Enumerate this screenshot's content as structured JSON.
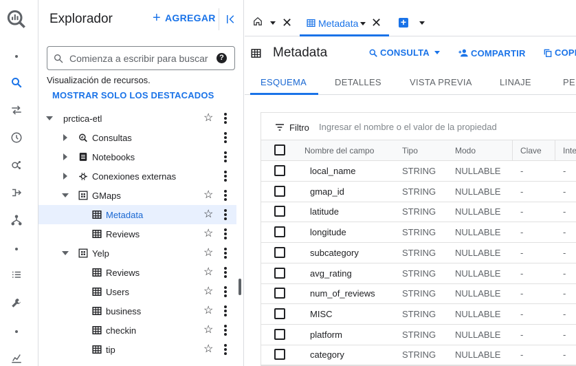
{
  "rail": {
    "items": [
      {
        "icon": "dot"
      },
      {
        "icon": "search-icon"
      },
      {
        "icon": "transfer-icon"
      },
      {
        "icon": "history-icon"
      },
      {
        "icon": "analytics-hub-icon"
      },
      {
        "icon": "dataflow-icon"
      },
      {
        "icon": "workflow-icon"
      },
      {
        "icon": "dot"
      },
      {
        "icon": "list-icon"
      },
      {
        "icon": "wrench-icon"
      },
      {
        "icon": "dot"
      },
      {
        "icon": "chart-icon"
      }
    ]
  },
  "explorer": {
    "title": "Explorador",
    "add_label": "AGREGAR",
    "search_placeholder": "Comienza a escribir para buscar",
    "visibility_text": "Visualización de recursos.",
    "starred_link": "MOSTRAR SOLO LOS DESTACADOS",
    "tree": [
      {
        "label": "prctica-etl",
        "level": 0,
        "caret": "down",
        "icon": "none",
        "star": true
      },
      {
        "label": "Consultas",
        "level": 1,
        "caret": "right",
        "icon": "query-icon",
        "star": false
      },
      {
        "label": "Notebooks",
        "level": 1,
        "caret": "right",
        "icon": "notebook-icon",
        "star": false
      },
      {
        "label": "Conexiones externas",
        "level": 1,
        "caret": "right",
        "icon": "connection-icon",
        "star": false
      },
      {
        "label": "GMaps",
        "level": 1,
        "caret": "down",
        "icon": "dataset-icon",
        "star": true
      },
      {
        "label": "Metadata",
        "level": 2,
        "caret": "none",
        "icon": "table-icon",
        "star": true,
        "selected": true
      },
      {
        "label": "Reviews",
        "level": 2,
        "caret": "none",
        "icon": "table-icon",
        "star": true
      },
      {
        "label": "Yelp",
        "level": 1,
        "caret": "down",
        "icon": "dataset-icon",
        "star": true
      },
      {
        "label": "Reviews",
        "level": 2,
        "caret": "none",
        "icon": "table-icon",
        "star": true
      },
      {
        "label": "Users",
        "level": 2,
        "caret": "none",
        "icon": "table-icon",
        "star": true
      },
      {
        "label": "business",
        "level": 2,
        "caret": "none",
        "icon": "table-icon",
        "star": true
      },
      {
        "label": "checkin",
        "level": 2,
        "caret": "none",
        "icon": "table-icon",
        "star": true
      },
      {
        "label": "tip",
        "level": 2,
        "caret": "none",
        "icon": "table-icon",
        "star": true
      }
    ]
  },
  "tabs": {
    "active_label": "Metadata"
  },
  "toolbar": {
    "title": "Metadata",
    "query_label": "CONSULTA",
    "share_label": "COMPARTIR",
    "copy_label": "COPIA"
  },
  "subtabs": [
    "ESQUEMA",
    "DETALLES",
    "VISTA PREVIA",
    "LINAJE",
    "PER"
  ],
  "schema": {
    "filter_label": "Filtro",
    "filter_placeholder": "Ingresar el nombre o el valor de la propiedad",
    "headers": {
      "name": "Nombre del campo",
      "type": "Tipo",
      "mode": "Modo",
      "key": "Clave",
      "int": "Inte"
    },
    "rows": [
      {
        "name": "local_name",
        "type": "STRING",
        "mode": "NULLABLE",
        "key": "-",
        "int": "-"
      },
      {
        "name": "gmap_id",
        "type": "STRING",
        "mode": "NULLABLE",
        "key": "-",
        "int": "-"
      },
      {
        "name": "latitude",
        "type": "STRING",
        "mode": "NULLABLE",
        "key": "-",
        "int": "-"
      },
      {
        "name": "longitude",
        "type": "STRING",
        "mode": "NULLABLE",
        "key": "-",
        "int": "-"
      },
      {
        "name": "subcategory",
        "type": "STRING",
        "mode": "NULLABLE",
        "key": "-",
        "int": "-"
      },
      {
        "name": "avg_rating",
        "type": "STRING",
        "mode": "NULLABLE",
        "key": "-",
        "int": "-"
      },
      {
        "name": "num_of_reviews",
        "type": "STRING",
        "mode": "NULLABLE",
        "key": "-",
        "int": "-"
      },
      {
        "name": "MISC",
        "type": "STRING",
        "mode": "NULLABLE",
        "key": "-",
        "int": "-"
      },
      {
        "name": "platform",
        "type": "STRING",
        "mode": "NULLABLE",
        "key": "-",
        "int": "-"
      },
      {
        "name": "category",
        "type": "STRING",
        "mode": "NULLABLE",
        "key": "-",
        "int": "-"
      }
    ]
  },
  "colors": {
    "accent": "#1a73e8",
    "selected_bg": "#e8f0fe",
    "border": "#dadce0"
  }
}
